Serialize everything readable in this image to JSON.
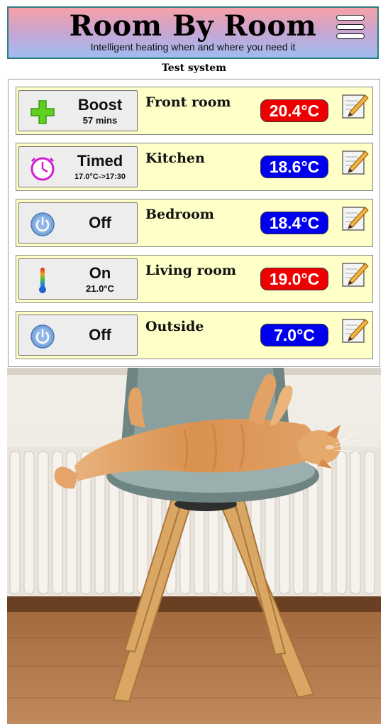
{
  "header": {
    "title": "Room By Room",
    "subtitle": "Intelligent heating when and where you need it",
    "menu_icon": "hamburger-menu-icon"
  },
  "system_label": "Test system",
  "colors": {
    "hot": "#ee0000",
    "cold": "#0000ee",
    "row_bg": "#ffffc8"
  },
  "rooms": [
    {
      "name": "Front room",
      "mode": "Boost",
      "mode_detail": "57 mins",
      "mode_icon": "plus-icon",
      "temperature": "20.4°C",
      "temp_status": "hot"
    },
    {
      "name": "Kitchen",
      "mode": "Timed",
      "mode_detail": "17.0°C->17:30",
      "mode_icon": "clock-icon",
      "temperature": "18.6°C",
      "temp_status": "cold"
    },
    {
      "name": "Bedroom",
      "mode": "Off",
      "mode_detail": "",
      "mode_icon": "power-icon",
      "temperature": "18.4°C",
      "temp_status": "cold"
    },
    {
      "name": "Living room",
      "mode": "On",
      "mode_detail": "21.0°C",
      "mode_icon": "thermometer-icon",
      "temperature": "19.0°C",
      "temp_status": "hot"
    },
    {
      "name": "Outside",
      "mode": "Off",
      "mode_detail": "",
      "mode_icon": "power-icon",
      "temperature": "7.0°C",
      "temp_status": "cold"
    }
  ]
}
